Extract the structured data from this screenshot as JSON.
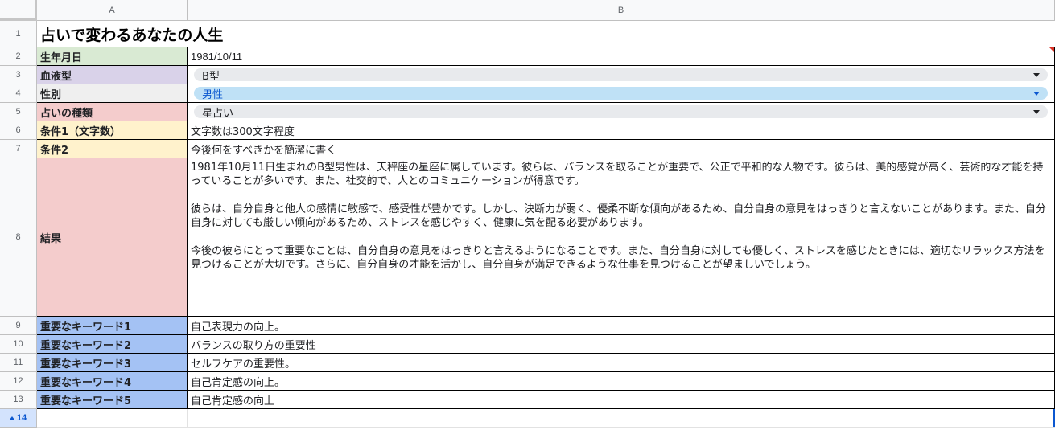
{
  "columns": {
    "a": "A",
    "b": "B"
  },
  "row_numbers": [
    "1",
    "2",
    "3",
    "4",
    "5",
    "6",
    "7",
    "8",
    "9",
    "10",
    "11",
    "12",
    "13",
    "14"
  ],
  "title": "占いで変わるあなたの人生",
  "rows": {
    "birthday": {
      "label": "生年月日",
      "value": "1981/10/11"
    },
    "blood": {
      "label": "血液型",
      "value": "B型"
    },
    "gender": {
      "label": "性別",
      "value": "男性"
    },
    "fortune_type": {
      "label": "占いの種類",
      "value": "星占い"
    },
    "cond1": {
      "label": "条件1（文字数）",
      "value": "文字数は300文字程度"
    },
    "cond2": {
      "label": "条件2",
      "value": "今後何をすべきかを簡潔に書く"
    },
    "result": {
      "label": "結果",
      "paragraphs": [
        "1981年10月11日生まれのB型男性は、天秤座の星座に属しています。彼らは、バランスを取ることが重要で、公正で平和的な人物です。彼らは、美的感覚が高く、芸術的な才能を持っていることが多いです。また、社交的で、人とのコミュニケーションが得意です。",
        "彼らは、自分自身と他人の感情に敏感で、感受性が豊かです。しかし、決断力が弱く、優柔不断な傾向があるため、自分自身の意見をはっきりと言えないことがあります。また、自分自身に対しても厳しい傾向があるため、ストレスを感じやすく、健康に気を配る必要があります。",
        "今後の彼らにとって重要なことは、自分自身の意見をはっきりと言えるようになることです。また、自分自身に対しても優しく、ストレスを感じたときには、適切なリラックス方法を見つけることが大切です。さらに、自分自身の才能を活かし、自分自身が満足できるような仕事を見つけることが望ましいでしょう。"
      ]
    },
    "kw1": {
      "label": "重要なキーワード1",
      "value": "自己表現力の向上。"
    },
    "kw2": {
      "label": "重要なキーワード2",
      "value": "バランスの取り方の重要性"
    },
    "kw3": {
      "label": "重要なキーワード3",
      "value": "セルフケアの重要性。"
    },
    "kw4": {
      "label": "重要なキーワード4",
      "value": "自己肯定感の向上。"
    },
    "kw5": {
      "label": "重要なキーワード5",
      "value": "自己肯定感の向上"
    }
  },
  "colors": {
    "green": "#d9ead3",
    "purple": "#d9d2e9",
    "gray": "#efefef",
    "red": "#f4cccc",
    "yellow": "#fff2cc",
    "blue": "#a4c2f4",
    "chip_selected": "#bfe1f6",
    "chip": "#e8eaed",
    "selection": "#0b57d0"
  },
  "icons": {
    "dropdown": "dropdown-arrow-icon",
    "note": "comment-indicator-icon"
  }
}
